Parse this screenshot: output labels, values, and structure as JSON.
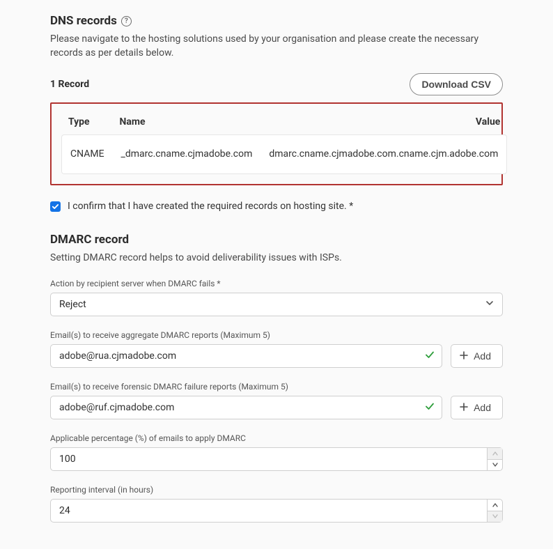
{
  "dns": {
    "title": "DNS records",
    "desc": "Please navigate to the hosting solutions used by your organisation and please create the necessary records as per details below.",
    "count_label": "1 Record",
    "download_label": "Download CSV",
    "headers": {
      "type": "Type",
      "name": "Name",
      "value": "Value"
    },
    "rows": [
      {
        "type": "CNAME",
        "name": "_dmarc.cname.cjmadobe.com",
        "value": "dmarc.cname.cjmadobe.com.cname.cjm.adobe.com"
      }
    ],
    "confirm_label": "I confirm that I have created the required records on hosting site. *"
  },
  "dmarc": {
    "title": "DMARC record",
    "desc": "Setting DMARC record helps to avoid deliverability issues with ISPs.",
    "action": {
      "label": "Action by recipient server when DMARC fails  *",
      "value": "Reject"
    },
    "aggregate": {
      "label": "Email(s) to receive aggregate DMARC reports (Maximum 5)",
      "value": "adobe@rua.cjmadobe.com",
      "add_label": "Add"
    },
    "forensic": {
      "label": "Email(s) to receive forensic DMARC failure reports (Maximum 5)",
      "value": "adobe@ruf.cjmadobe.com",
      "add_label": "Add"
    },
    "percentage": {
      "label": "Applicable percentage (%) of emails to apply DMARC",
      "value": "100"
    },
    "interval": {
      "label": "Reporting interval (in hours)",
      "value": "24"
    }
  }
}
